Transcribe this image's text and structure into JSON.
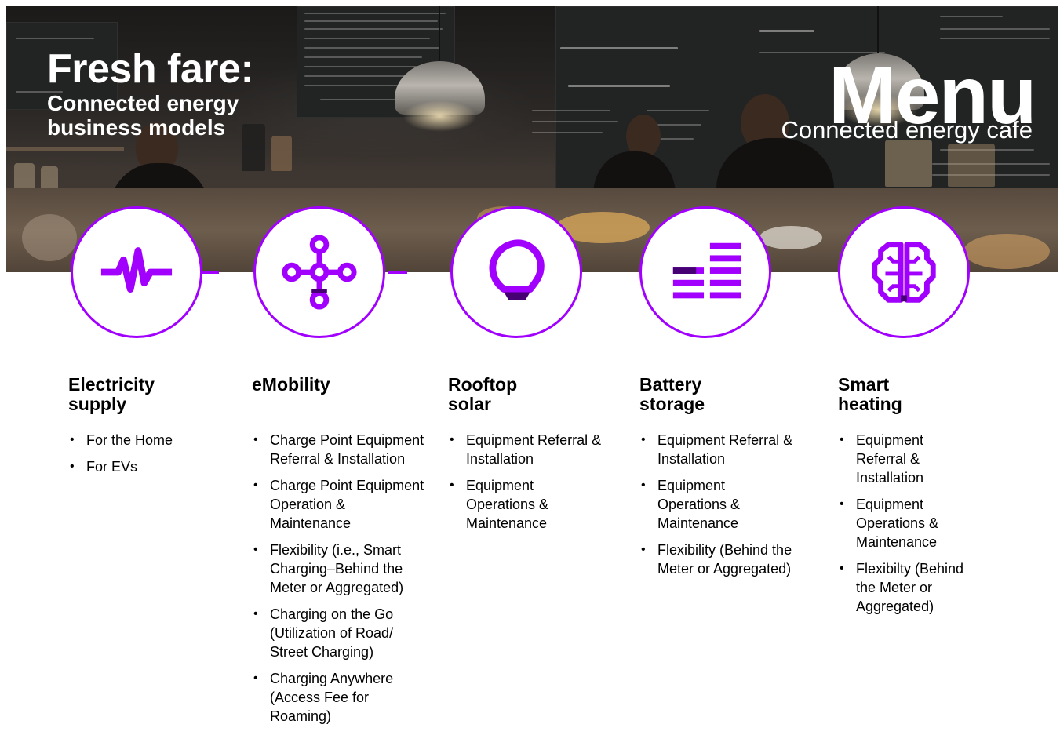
{
  "hero": {
    "title": "Fresh fare:",
    "subtitle": "Connected energy business models",
    "menu_title": "Menu",
    "menu_subtitle": "Connected energy cafe"
  },
  "accent_color": "#a100ff",
  "services": [
    {
      "title": "Electricity supply",
      "icon": "pulse-icon",
      "items": [
        "For the Home",
        "For EVs"
      ]
    },
    {
      "title": "eMobility",
      "icon": "network-nodes-icon",
      "items": [
        "Charge Point Equipment Referral & Installation",
        "Charge Point Equipment Operation & Maintenance",
        "Flexibility (i.e., Smart Charging–Behind the Meter or Aggregated)",
        "Charging on the Go (Utilization of Road/ Street Charging)",
        "Charging Anywhere (Access Fee for Roaming)"
      ]
    },
    {
      "title": "Rooftop solar",
      "icon": "lightbulb-icon",
      "items": [
        "Equipment Referral & Installation",
        "Equipment Operations & Maintenance"
      ]
    },
    {
      "title": "Battery storage",
      "icon": "battery-bars-icon",
      "items": [
        "Equipment Referral & Installation",
        "Equipment Operations & Maintenance",
        "Flexibility (Behind the Meter or Aggregated)"
      ]
    },
    {
      "title": "Smart heating",
      "icon": "brain-circuit-icon",
      "items": [
        "Equipment Referral & Installation",
        "Equipment Operations & Maintenance",
        "Flexibilty (Behind the Meter or Aggregated)"
      ]
    }
  ]
}
